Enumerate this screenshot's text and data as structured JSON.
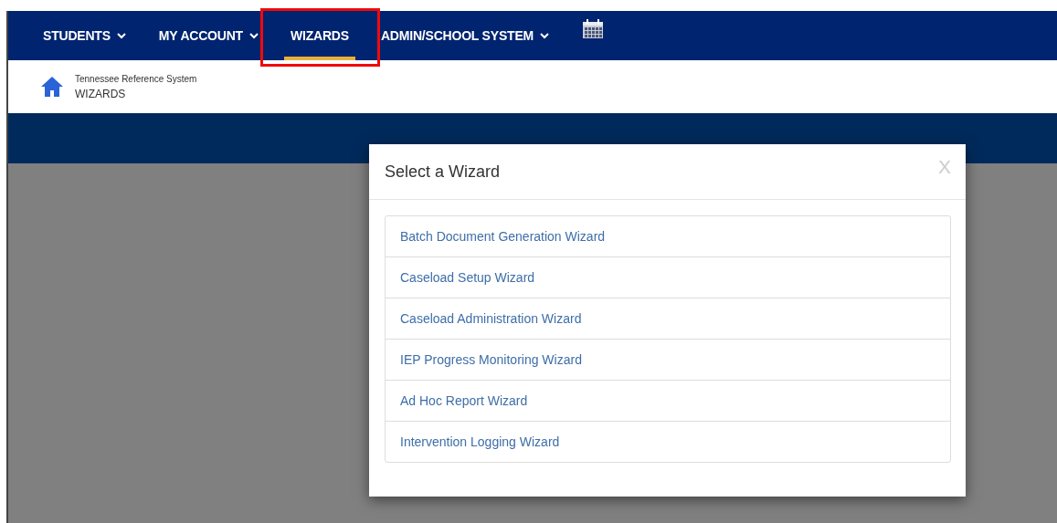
{
  "nav": {
    "items": [
      {
        "label": "STUDENTS",
        "kind": "dropdown",
        "selected": false,
        "highlighted": false
      },
      {
        "label": "MY ACCOUNT",
        "kind": "dropdown",
        "selected": false,
        "highlighted": false
      },
      {
        "label": "WIZARDS",
        "kind": "link",
        "selected": true,
        "highlighted": true
      },
      {
        "label": "ADMIN/SCHOOL SYSTEM",
        "kind": "dropdown",
        "selected": false,
        "highlighted": false
      },
      {
        "kind": "calendar",
        "selected": false,
        "highlighted": false
      }
    ]
  },
  "breadcrumb": {
    "system": "Tennessee Reference System",
    "page": "WIZARDS"
  },
  "modal": {
    "title": "Select a Wizard",
    "close": "X",
    "items": [
      "Batch Document Generation Wizard",
      "Caseload Setup Wizard",
      "Caseload Administration Wizard",
      "IEP Progress Monitoring Wizard",
      "Ad Hoc Report Wizard",
      "Intervention Logging Wizard"
    ]
  }
}
